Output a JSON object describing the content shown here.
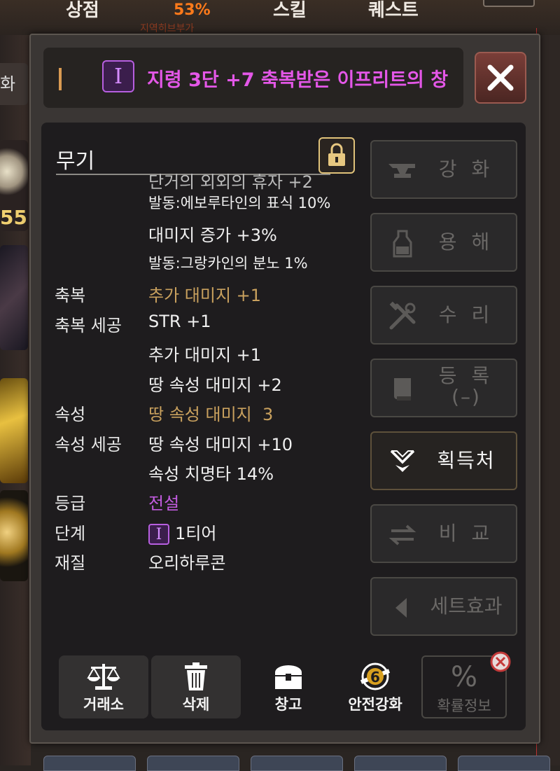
{
  "top_nav": {
    "tabs": [
      "상점",
      "스킬",
      "퀘스트"
    ],
    "progress_percent": "53%",
    "progress_sub": "지역히브부가"
  },
  "left_strip": {
    "count_label": "55",
    "partial_label": "화"
  },
  "title_bar": {
    "tier_badge": "I",
    "item_name": "지령 3단 +7 축복받은 이프리트의 창"
  },
  "section": {
    "title": "무기"
  },
  "stats": {
    "cut_text": "단거의 외외의 휴자 +2",
    "rows": [
      {
        "label": "",
        "value": "발동:에보루타인의 표식 10%",
        "style": "small"
      },
      {
        "label": "",
        "value": "대미지 증가 +3%",
        "style": "normal"
      },
      {
        "label": "",
        "value": "발동:그랑카인의 분노 1%",
        "style": "small"
      },
      {
        "label": "축복",
        "value": "추가 대미지 +1",
        "style": "gold"
      },
      {
        "label": "축복 세공",
        "value": "STR +1",
        "style": "normal"
      },
      {
        "label": "",
        "value": "추가 대미지 +1",
        "style": "normal"
      },
      {
        "label": "",
        "value": "땅 속성 대미지 +2",
        "style": "normal"
      },
      {
        "label": "속성",
        "value": "땅 속성 대미지  3",
        "style": "gold"
      },
      {
        "label": "속성 세공",
        "value": "땅 속성 대미지 +10",
        "style": "normal"
      },
      {
        "label": "",
        "value": "속성 치명타 14%",
        "style": "normal"
      },
      {
        "label": "등급",
        "value": "전설",
        "style": "purple"
      },
      {
        "label": "단계",
        "value": "1티어",
        "style": "tier"
      },
      {
        "label": "재질",
        "value": "오리하루콘",
        "style": "normal"
      }
    ]
  },
  "side_buttons": [
    {
      "label": "강 화",
      "icon": "anvil-icon",
      "enabled": false
    },
    {
      "label": "용 해",
      "icon": "bottle-icon",
      "enabled": false
    },
    {
      "label": "수 리",
      "icon": "tools-icon",
      "enabled": false
    },
    {
      "label": "등 록",
      "sub": "(–)",
      "icon": "book-icon",
      "enabled": false
    },
    {
      "label": "획득처",
      "icon": "source-icon",
      "enabled": true
    },
    {
      "label": "비 교",
      "icon": "swap-icon",
      "enabled": false
    },
    {
      "label": "세트효과",
      "icon": "triangle-left-icon",
      "enabled": false
    }
  ],
  "bottom_buttons": [
    {
      "label": "거래소",
      "icon": "scale-icon"
    },
    {
      "label": "삭제",
      "icon": "trash-icon"
    },
    {
      "label": "창고",
      "icon": "chest-icon"
    },
    {
      "label": "안전강화",
      "icon": "safe-enhance-icon",
      "badge": "6"
    },
    {
      "label": "확률정보",
      "icon": "percent-icon",
      "glyph": "%"
    }
  ],
  "colors": {
    "title_purple": "#e457e8",
    "gold_text": "#c9a15e",
    "legend_purple": "#c25ce0",
    "progress_orange": "#ff7a1a"
  }
}
